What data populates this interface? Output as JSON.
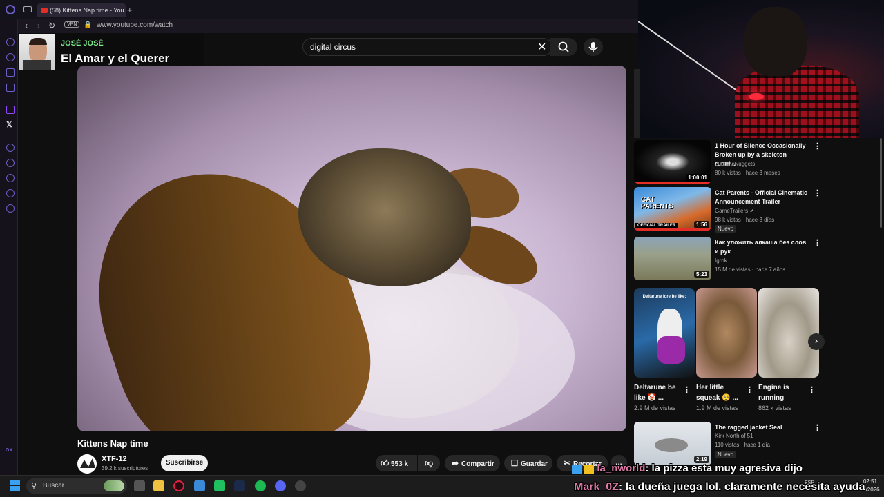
{
  "browser": {
    "tab_title": "(58) Kittens Nap time - You",
    "new_tab": "+",
    "vpn": "VPN",
    "url": "www.youtube.com/watch"
  },
  "now_playing": {
    "artist": "JOSÉ JOSÉ",
    "song": "El Amar y el Querer"
  },
  "youtube": {
    "search_value": "digital circus",
    "video_title": "Kittens Nap time",
    "channel_name": "XTF-12",
    "subscribers": "39.2 k suscriptores",
    "subscribe_label": "Suscribirse",
    "like_count": "553 k",
    "share_label": "Compartir",
    "save_label": "Guardar",
    "clip_label": "Recortar",
    "more_label": "…"
  },
  "recommendations": [
    {
      "title": "1 Hour of Silence Occasionally Broken up by a skeleton runni...",
      "channel": "2000McNuggets",
      "meta": "80 k vistas · hace 3 meses",
      "duration": "1:00:01",
      "badge": ""
    },
    {
      "title": "Cat Parents - Official Cinematic Announcement Trailer",
      "channel": "GameTrailers ✔",
      "meta": "98 k vistas · hace 3 días",
      "duration": "1:56",
      "badge": "Nuevo"
    },
    {
      "title": "Как уложить алкаша без слов и рук",
      "channel": "Igrok",
      "meta": "15 M de vistas · hace 7 años",
      "duration": "5:23",
      "badge": ""
    },
    {
      "title": "The ragged jacket Seal",
      "channel": "Kirk North of 51",
      "meta": "110 vistas · hace 1 día",
      "duration": "2:19",
      "badge": "Nuevo"
    }
  ],
  "thumb_text": {
    "cat_parents_logo": "CAT PARENTS",
    "official_trailer": "OFFICIAL TRAILER",
    "deltarune_caption": "Deltarune lore be like:"
  },
  "shorts": [
    {
      "title": "Deltarune be like 🤡 ...",
      "views": "2.9 M de vistas"
    },
    {
      "title": "Her little squeak 🥺 ...",
      "views": "1.9 M de vistas"
    },
    {
      "title": "Engine is running",
      "views": "862 k vistas"
    }
  ],
  "chat": [
    {
      "user": "la_nworld",
      "message": ": la pizza esta muy agresiva dijo"
    },
    {
      "user": "Mark_0Z",
      "message": ": la dueña juega lol. claramente necesita ayuda"
    }
  ],
  "taskbar": {
    "search_placeholder": "Buscar",
    "lang": "ESP",
    "time": "02:51",
    "date": "21/3/2026"
  },
  "sidebar_footer": "GX",
  "colors": {
    "accent": "#6b5fc9",
    "youtube_red": "#e52d27",
    "artist_green": "#7ee68b",
    "chat_user": "#e07aa8"
  }
}
